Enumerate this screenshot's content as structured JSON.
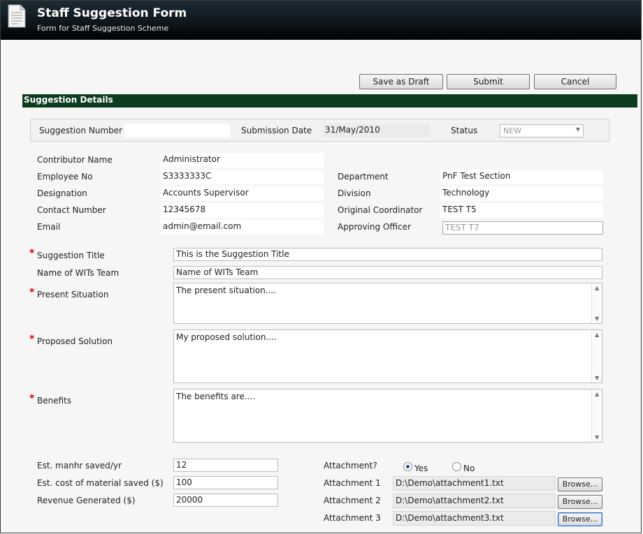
{
  "header": {
    "title": "Staff Suggestion Form",
    "subtitle": "Form for Staff Suggestion Scheme"
  },
  "toolbar": {
    "save_draft": "Save as Draft",
    "submit": "Submit",
    "cancel": "Cancel"
  },
  "section": {
    "title": "Suggestion Details"
  },
  "meta": {
    "suggestion_number_label": "Suggestion Number",
    "suggestion_number_value": "",
    "submission_date_label": "Submission Date",
    "submission_date_value": "31/May/2010",
    "status_label": "Status",
    "status_value": "NEW"
  },
  "contributor": {
    "name_label": "Contributor Name",
    "name_value": "Administrator",
    "emp_label": "Employee No",
    "emp_value": "S3333333C",
    "designation_label": "Designation",
    "designation_value": "Accounts Supervisor",
    "contact_label": "Contact Number",
    "contact_value": "12345678",
    "email_label": "Email",
    "email_value": "admin@email.com",
    "department_label": "Department",
    "department_value": "PnF Test Section",
    "division_label": "Division",
    "division_value": "Technology",
    "coordinator_label": "Original Coordinator",
    "coordinator_value": "TEST T5",
    "approver_label": "Approving Officer",
    "approver_value": "TEST T7"
  },
  "suggestion": {
    "required_mark": "*",
    "title_label": "Suggestion Title",
    "title_value": "This is the Suggestion Title",
    "team_label": "Name of WITs Team",
    "team_value": "Name of WITs Team",
    "present_label": "Present Situation",
    "present_value": "The present situation....",
    "proposed_label": "Proposed Solution",
    "proposed_value": "My proposed solution....",
    "benefits_label": "Benefits",
    "benefits_value": "The benefits are...."
  },
  "estimates": {
    "manhr_label": "Est. manhr saved/yr",
    "manhr_value": "12",
    "cost_label": "Est. cost of material saved ($)",
    "cost_value": "100",
    "revenue_label": "Revenue Generated ($)",
    "revenue_value": "20000"
  },
  "attachments": {
    "question_label": "Attachment?",
    "yes_label": "Yes",
    "no_label": "No",
    "selected": "Yes",
    "browse_label": "Browse...",
    "items": [
      {
        "label": "Attachment 1",
        "path": "D:\\Demo\\attachment1.txt"
      },
      {
        "label": "Attachment 2",
        "path": "D:\\Demo\\attachment2.txt"
      },
      {
        "label": "Attachment 3",
        "path": "D:\\Demo\\attachment3.txt"
      }
    ]
  },
  "colors": {
    "titlebar": "#0f171d",
    "section_header": "#0b3c1e",
    "required": "#d40000"
  }
}
